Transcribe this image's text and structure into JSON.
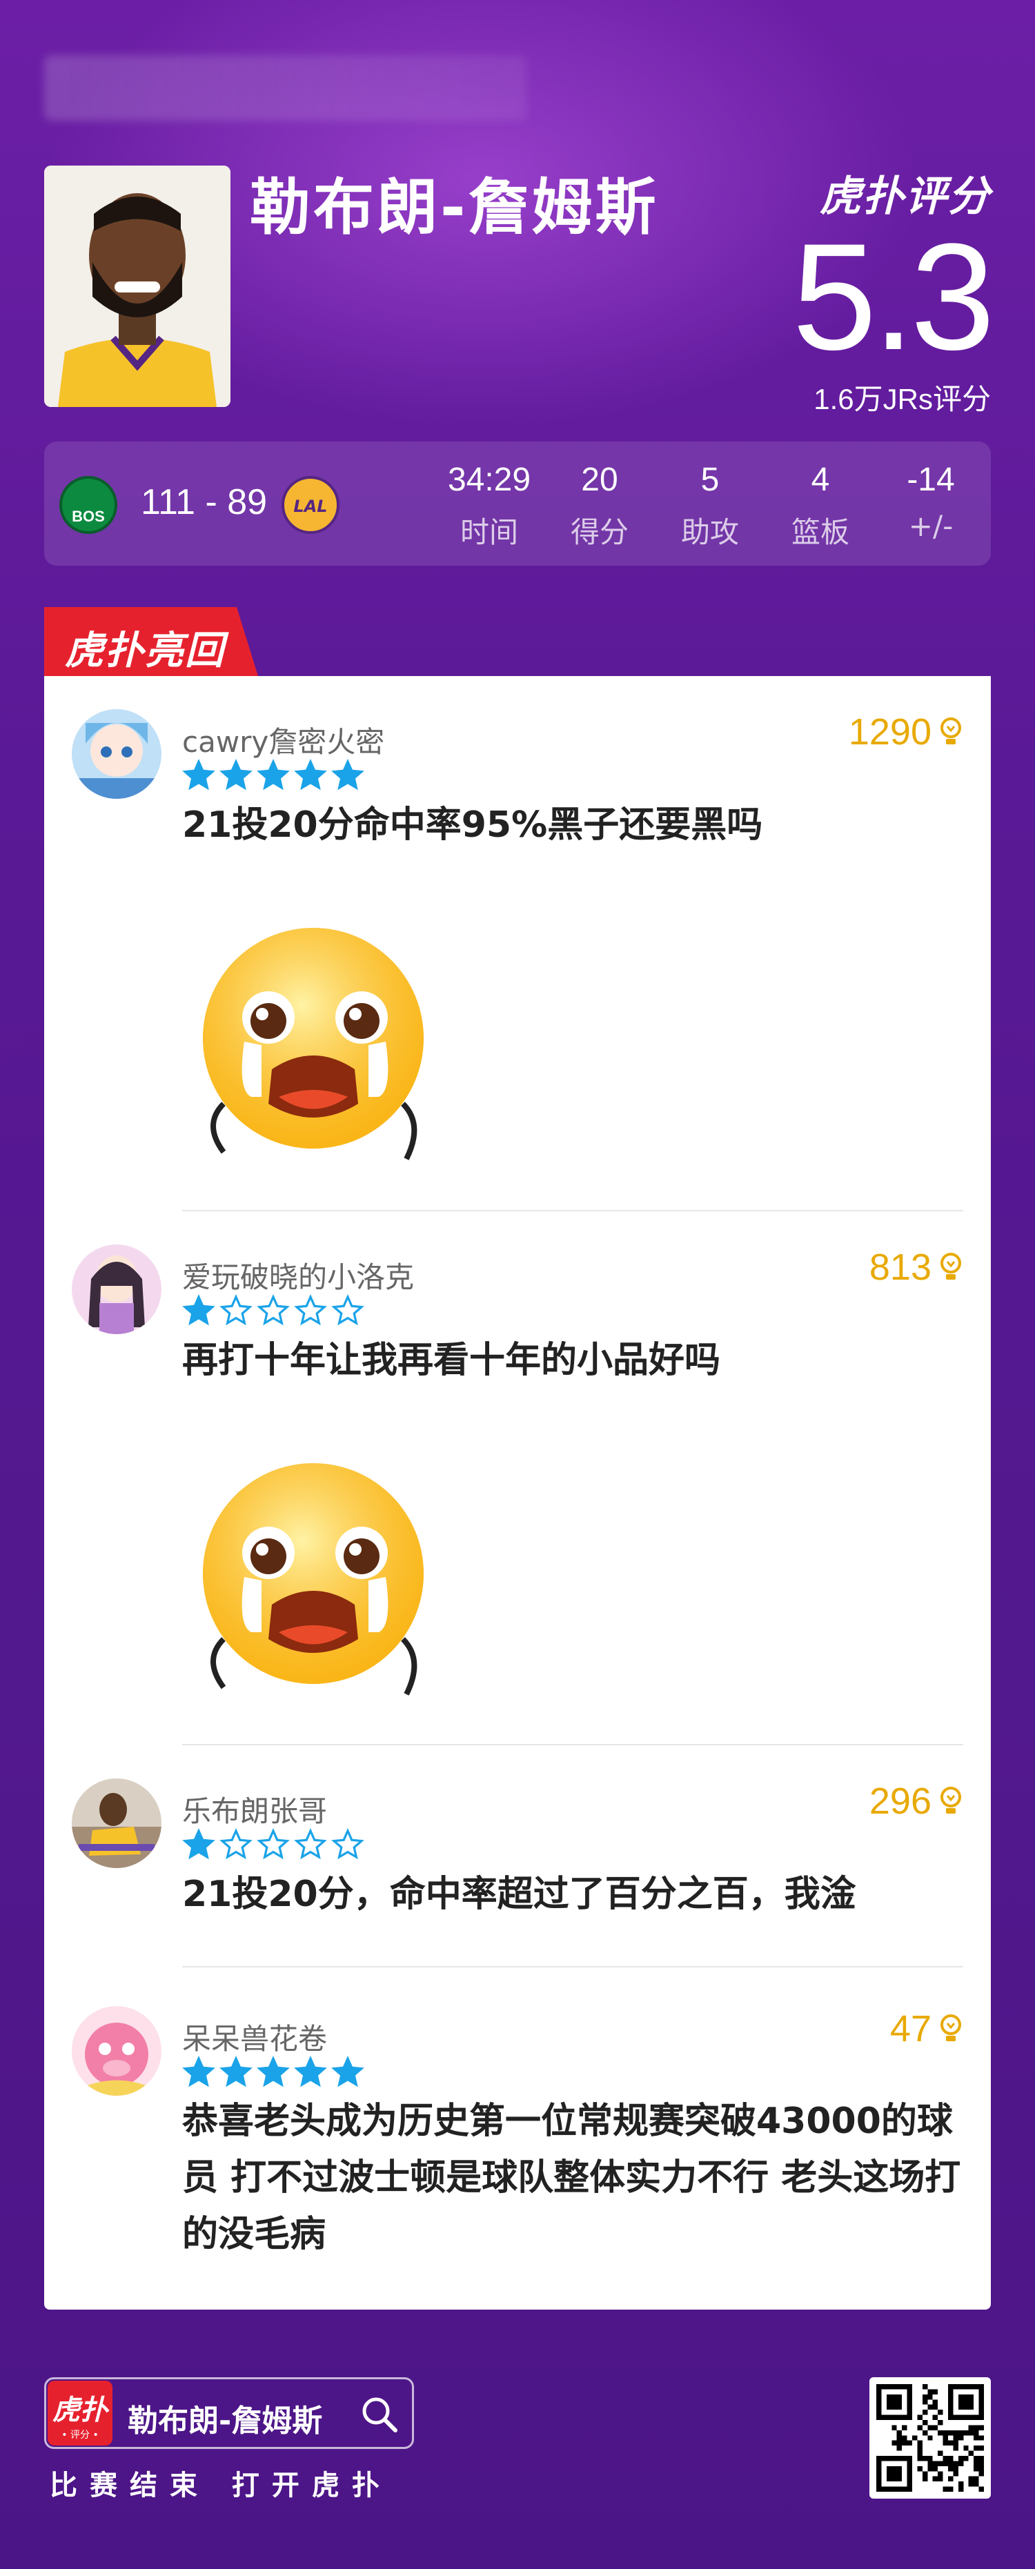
{
  "player": {
    "name": "勒布朗-詹姆斯"
  },
  "brand": {
    "rating_logo": "虎扑评分"
  },
  "rating": {
    "score": "5.3",
    "count": "1.6万JRs评分"
  },
  "game": {
    "home_team": "BOS",
    "away_team": "LAL",
    "score": "111 - 89",
    "stats": [
      {
        "value": "34:29",
        "label": "时间"
      },
      {
        "value": "20",
        "label": "得分"
      },
      {
        "value": "5",
        "label": "助攻"
      },
      {
        "value": "4",
        "label": "篮板"
      },
      {
        "value": "-14",
        "label": "+/-"
      }
    ]
  },
  "section": {
    "hot_replies": "虎扑亮回复"
  },
  "comments": [
    {
      "user": "cawry詹密火密",
      "likes": "1290",
      "stars": 5,
      "text": "21投20分命中率95%黑子还要黑吗",
      "has_emoji": true
    },
    {
      "user": "爱玩破晓的小洛克",
      "likes": "813",
      "stars": 1,
      "text": "再打十年让我再看十年的小品好吗",
      "has_emoji": true
    },
    {
      "user": "乐布朗张哥",
      "likes": "296",
      "stars": 1,
      "text": "21投20分，命中率超过了百分之百，我淦",
      "has_emoji": false
    },
    {
      "user": "呆呆兽花卷",
      "likes": "47",
      "stars": 5,
      "text": "恭喜老头成为历史第一位常规赛突破43000的球员 打不过波士顿是球队整体实力不行 老头这场打的没毛病",
      "has_emoji": false
    }
  ],
  "footer": {
    "app_icon": "虎扑",
    "app_icon_sub": "• 评分 •",
    "search_text": "勒布朗-詹姆斯",
    "slogan": "比赛结束 打开虎扑"
  },
  "colors": {
    "accent_red": "#e6212e",
    "likes_gold": "#e8a900",
    "star_blue": "#1aa3e8",
    "background": "#5a1996"
  }
}
